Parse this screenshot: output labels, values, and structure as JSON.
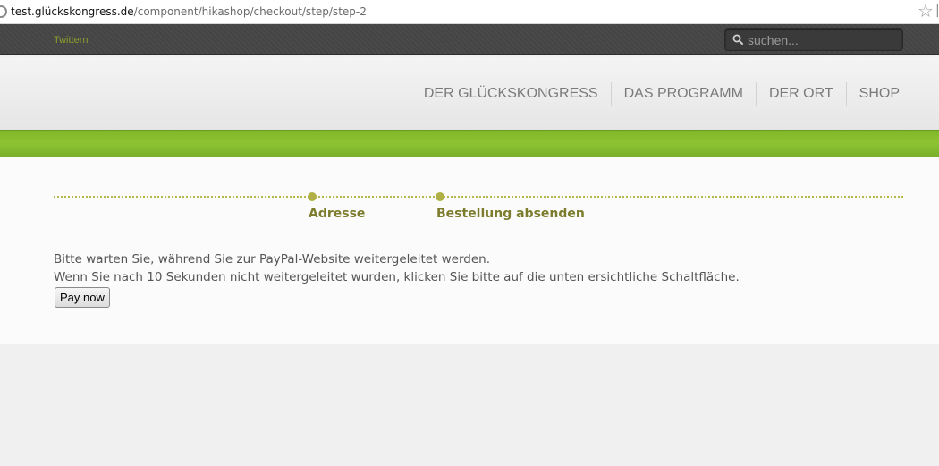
{
  "browser": {
    "url_host": "test.glückskongress.de",
    "url_path": "/component/hikashop/checkout/step/step-2"
  },
  "topbar": {
    "twitter_link": "Twittern",
    "search_placeholder": "suchen..."
  },
  "nav": {
    "items": [
      {
        "label": "DER GLÜCKSKONGRESS"
      },
      {
        "label": "DAS PROGRAMM"
      },
      {
        "label": "DER ORT"
      },
      {
        "label": "SHOP"
      }
    ]
  },
  "checkout": {
    "steps": [
      {
        "label": "Adresse"
      },
      {
        "label": "Bestellung absenden"
      }
    ],
    "message_line1": "Bitte warten Sie, während Sie zur PayPal-Website weitergeleitet werden.",
    "message_line2": "Wenn Sie nach 10 Sekunden nicht weitergeleitet wurden, klicken Sie bitte auf die unten ersichtliche Schaltfläche.",
    "pay_button": "Pay now"
  },
  "colors": {
    "accent_green": "#8ec433",
    "step_color": "#7c7c2c"
  }
}
